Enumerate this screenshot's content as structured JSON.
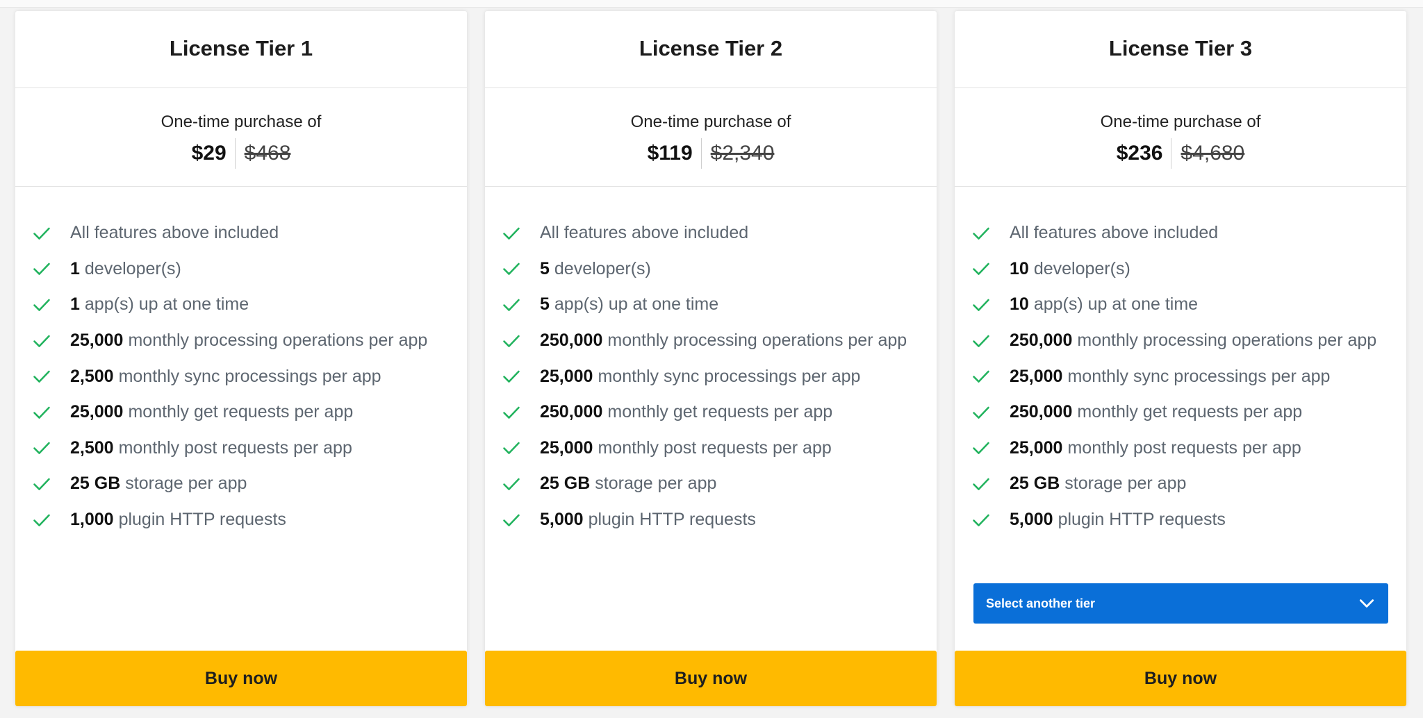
{
  "colors": {
    "accent": "#ffba00",
    "check": "#22b35e",
    "select": "#0a6fd8"
  },
  "tiers": [
    {
      "title": "License Tier 1",
      "price_caption": "One-time purchase of",
      "price_now": "$29",
      "price_old": "$468",
      "features": [
        {
          "bold": "",
          "text": "All features above included"
        },
        {
          "bold": "1",
          "text": "developer(s)"
        },
        {
          "bold": "1",
          "text": "app(s) up at one time"
        },
        {
          "bold": "25,000",
          "text": "monthly processing operations per app"
        },
        {
          "bold": "2,500",
          "text": "monthly sync processings per app"
        },
        {
          "bold": "25,000",
          "text": "monthly get requests per app"
        },
        {
          "bold": "2,500",
          "text": "monthly post requests per app"
        },
        {
          "bold": "25 GB",
          "text": "storage per app"
        },
        {
          "bold": "1,000",
          "text": "plugin HTTP requests"
        }
      ],
      "buy_label": "Buy now"
    },
    {
      "title": "License Tier 2",
      "price_caption": "One-time purchase of",
      "price_now": "$119",
      "price_old": "$2,340",
      "features": [
        {
          "bold": "",
          "text": "All features above included"
        },
        {
          "bold": "5",
          "text": "developer(s)"
        },
        {
          "bold": "5",
          "text": "app(s) up at one time"
        },
        {
          "bold": "250,000",
          "text": "monthly processing operations per app"
        },
        {
          "bold": "25,000",
          "text": "monthly sync processings per app"
        },
        {
          "bold": "250,000",
          "text": "monthly get requests per app"
        },
        {
          "bold": "25,000",
          "text": "monthly post requests per app"
        },
        {
          "bold": "25 GB",
          "text": "storage per app"
        },
        {
          "bold": "5,000",
          "text": "plugin HTTP requests"
        }
      ],
      "buy_label": "Buy now"
    },
    {
      "title": "License Tier 3",
      "price_caption": "One-time purchase of",
      "price_now": "$236",
      "price_old": "$4,680",
      "features": [
        {
          "bold": "",
          "text": "All features above included"
        },
        {
          "bold": "10",
          "text": "developer(s)"
        },
        {
          "bold": "10",
          "text": "app(s) up at one time"
        },
        {
          "bold": "250,000",
          "text": "monthly processing operations per app"
        },
        {
          "bold": "25,000",
          "text": "monthly sync processings per app"
        },
        {
          "bold": "250,000",
          "text": "monthly get requests per app"
        },
        {
          "bold": "25,000",
          "text": "monthly post requests per app"
        },
        {
          "bold": "25 GB",
          "text": "storage per app"
        },
        {
          "bold": "5,000",
          "text": "plugin HTTP requests"
        }
      ],
      "select_label": "Select another tier",
      "buy_label": "Buy now"
    }
  ]
}
